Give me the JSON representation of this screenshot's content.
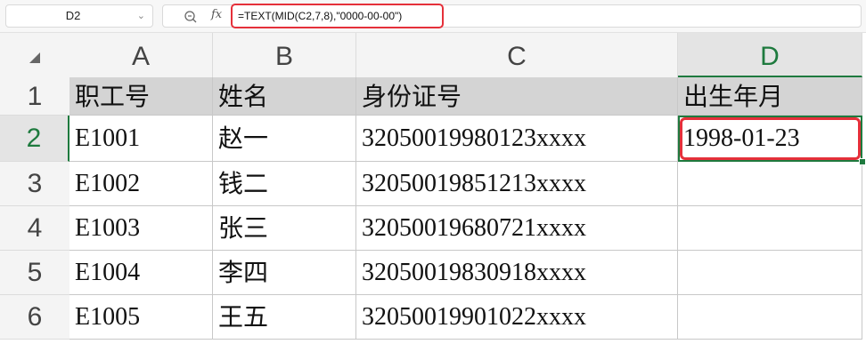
{
  "formula_bar": {
    "cell_ref": "D2",
    "formula": "=TEXT(MID(C2,7,8),\"0000-00-00\")",
    "fx_label": "fx"
  },
  "columns": [
    "A",
    "B",
    "C",
    "D"
  ],
  "rows": [
    "1",
    "2",
    "3",
    "4",
    "5",
    "6"
  ],
  "headers": {
    "a": "职工号",
    "b": "姓名",
    "c": "身份证号",
    "d": "出生年月"
  },
  "data_rows": [
    {
      "id": "E1001",
      "name": "赵一",
      "idnum": "32050019980123xxxx",
      "birth": "1998-01-23"
    },
    {
      "id": "E1002",
      "name": "钱二",
      "idnum": "32050019851213xxxx",
      "birth": ""
    },
    {
      "id": "E1003",
      "name": "张三",
      "idnum": "32050019680721xxxx",
      "birth": ""
    },
    {
      "id": "E1004",
      "name": "李四",
      "idnum": "32050019830918xxxx",
      "birth": ""
    },
    {
      "id": "E1005",
      "name": "王五",
      "idnum": "32050019901022xxxx",
      "birth": ""
    }
  ],
  "colors": {
    "accent": "#1e7a3e",
    "highlight": "#e5303a",
    "header_fill": "#d4d4d4"
  }
}
